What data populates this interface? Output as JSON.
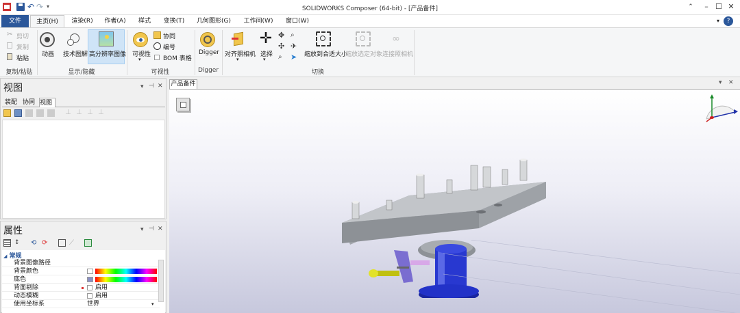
{
  "app": {
    "title": "SOLIDWORKS Composer (64-bit) - [产品备件]",
    "colors": {
      "file_tab": "#2b579a",
      "selected": "#cfe4f7",
      "model_plate": "#9a9ea3",
      "model_cylinder": "#2a3fd8"
    }
  },
  "window_controls": {
    "minimize": "–",
    "restore": "☐",
    "close": "✕",
    "ribbon_toggle": "⌃",
    "help": "?"
  },
  "tabs": [
    "文件",
    "主页(H)",
    "渲染(R)",
    "作者(A)",
    "样式",
    "变换(T)",
    "几何图形(G)",
    "工作间(W)",
    "窗口(W)"
  ],
  "ribbon": {
    "clipboard": {
      "cut": "剪切",
      "copy": "复制",
      "paste": "粘贴",
      "label": "复制/粘贴"
    },
    "show_hide": {
      "animation": "动画",
      "tech_illustration": "技术图解",
      "hires_image": "高分辨率图像",
      "label": "显示/隐藏"
    },
    "visibility": {
      "visibility": "可视性",
      "collab": "协同",
      "number": "编号",
      "bom": "BOM 表格",
      "label": "可视性"
    },
    "digger": {
      "digger": "Digger",
      "label": "Digger"
    },
    "switch": {
      "align_camera": "对齐照相机",
      "select": "选择",
      "zoom_fit": "缩放到合适大小",
      "zoom_selected": "缩放选定对象",
      "pan_camera": "连接照相机",
      "label": "切换"
    }
  },
  "views_panel": {
    "title": "视图",
    "tabs": [
      "装配",
      "协同",
      "视图"
    ],
    "active_tab": "视图"
  },
  "props_panel": {
    "title": "属性",
    "section": "常规",
    "rows": [
      {
        "key": "背景图像路径",
        "value": ""
      },
      {
        "key": "背景颜色",
        "value": ""
      },
      {
        "key": "底色",
        "value": ""
      },
      {
        "key": "背面剔除",
        "value": "启用"
      },
      {
        "key": "动态模糊",
        "value": "启用"
      },
      {
        "key": "使用坐标系",
        "value": "世界"
      }
    ]
  },
  "document": {
    "tab_label": "产品备件"
  }
}
